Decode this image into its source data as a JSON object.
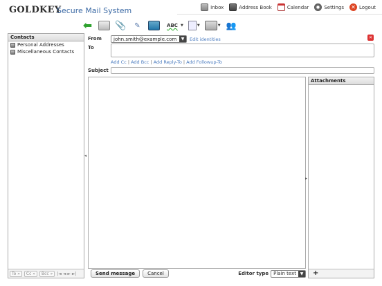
{
  "app": {
    "logo_main": "GoldKey",
    "logo_sub": "Secure Mail System"
  },
  "topnav": [
    {
      "icon": "inbox-icon",
      "label": "Inbox"
    },
    {
      "icon": "address-book-icon",
      "label": "Address Book"
    },
    {
      "icon": "calendar-icon",
      "label": "Calendar"
    },
    {
      "icon": "gear-icon",
      "label": "Settings"
    },
    {
      "icon": "logout-icon",
      "label": "Logout"
    }
  ],
  "toolbar": {
    "icons": [
      "back-arrow-icon",
      "send-envelope-icon",
      "attachment-icon",
      "signature-icon",
      "insert-image-icon",
      "spellcheck-icon",
      "document-icon",
      "identity-card-icon",
      "contacts-icon"
    ],
    "spellcheck_text": "ABC"
  },
  "contacts": {
    "title": "Contacts",
    "items": [
      "Personal Addresses",
      "Miscellaneous Contacts"
    ],
    "footer_buttons": [
      "To »",
      "Cc »",
      "Bcc »"
    ],
    "pager": "|◄ ◄ ► ►|"
  },
  "compose": {
    "from_label": "From",
    "from_value": "john.smith@example.com",
    "edit_identities": "Edit identities",
    "to_label": "To",
    "add_links": [
      "Add Cc",
      "Add Bcc",
      "Add Reply-To",
      "Add Followup-To"
    ],
    "subject_label": "Subject",
    "subject_value": ""
  },
  "attachments": {
    "title": "Attachments",
    "add_label": "+"
  },
  "bottom": {
    "send_label": "Send message",
    "cancel_label": "Cancel",
    "editor_type_label": "Editor type",
    "editor_type_value": "Plain text"
  },
  "colors": {
    "link": "#4a7bbf",
    "logo_sub": "#3c6aa5",
    "logout": "#dd4422"
  }
}
